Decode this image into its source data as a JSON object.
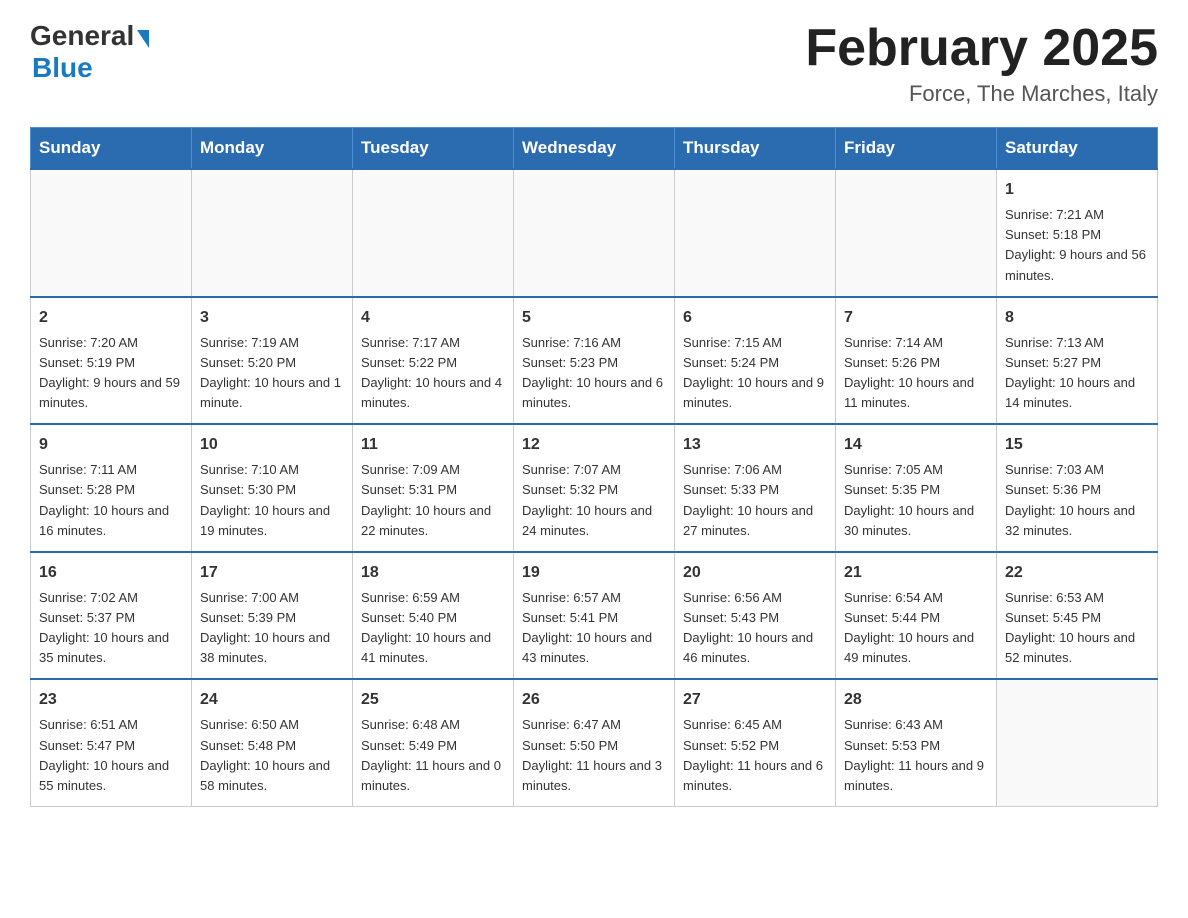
{
  "logo": {
    "general_text": "General",
    "blue_text": "Blue"
  },
  "header": {
    "month_year": "February 2025",
    "location": "Force, The Marches, Italy"
  },
  "days_of_week": [
    "Sunday",
    "Monday",
    "Tuesday",
    "Wednesday",
    "Thursday",
    "Friday",
    "Saturday"
  ],
  "weeks": [
    [
      {
        "day": "",
        "info": ""
      },
      {
        "day": "",
        "info": ""
      },
      {
        "day": "",
        "info": ""
      },
      {
        "day": "",
        "info": ""
      },
      {
        "day": "",
        "info": ""
      },
      {
        "day": "",
        "info": ""
      },
      {
        "day": "1",
        "info": "Sunrise: 7:21 AM\nSunset: 5:18 PM\nDaylight: 9 hours and 56 minutes."
      }
    ],
    [
      {
        "day": "2",
        "info": "Sunrise: 7:20 AM\nSunset: 5:19 PM\nDaylight: 9 hours and 59 minutes."
      },
      {
        "day": "3",
        "info": "Sunrise: 7:19 AM\nSunset: 5:20 PM\nDaylight: 10 hours and 1 minute."
      },
      {
        "day": "4",
        "info": "Sunrise: 7:17 AM\nSunset: 5:22 PM\nDaylight: 10 hours and 4 minutes."
      },
      {
        "day": "5",
        "info": "Sunrise: 7:16 AM\nSunset: 5:23 PM\nDaylight: 10 hours and 6 minutes."
      },
      {
        "day": "6",
        "info": "Sunrise: 7:15 AM\nSunset: 5:24 PM\nDaylight: 10 hours and 9 minutes."
      },
      {
        "day": "7",
        "info": "Sunrise: 7:14 AM\nSunset: 5:26 PM\nDaylight: 10 hours and 11 minutes."
      },
      {
        "day": "8",
        "info": "Sunrise: 7:13 AM\nSunset: 5:27 PM\nDaylight: 10 hours and 14 minutes."
      }
    ],
    [
      {
        "day": "9",
        "info": "Sunrise: 7:11 AM\nSunset: 5:28 PM\nDaylight: 10 hours and 16 minutes."
      },
      {
        "day": "10",
        "info": "Sunrise: 7:10 AM\nSunset: 5:30 PM\nDaylight: 10 hours and 19 minutes."
      },
      {
        "day": "11",
        "info": "Sunrise: 7:09 AM\nSunset: 5:31 PM\nDaylight: 10 hours and 22 minutes."
      },
      {
        "day": "12",
        "info": "Sunrise: 7:07 AM\nSunset: 5:32 PM\nDaylight: 10 hours and 24 minutes."
      },
      {
        "day": "13",
        "info": "Sunrise: 7:06 AM\nSunset: 5:33 PM\nDaylight: 10 hours and 27 minutes."
      },
      {
        "day": "14",
        "info": "Sunrise: 7:05 AM\nSunset: 5:35 PM\nDaylight: 10 hours and 30 minutes."
      },
      {
        "day": "15",
        "info": "Sunrise: 7:03 AM\nSunset: 5:36 PM\nDaylight: 10 hours and 32 minutes."
      }
    ],
    [
      {
        "day": "16",
        "info": "Sunrise: 7:02 AM\nSunset: 5:37 PM\nDaylight: 10 hours and 35 minutes."
      },
      {
        "day": "17",
        "info": "Sunrise: 7:00 AM\nSunset: 5:39 PM\nDaylight: 10 hours and 38 minutes."
      },
      {
        "day": "18",
        "info": "Sunrise: 6:59 AM\nSunset: 5:40 PM\nDaylight: 10 hours and 41 minutes."
      },
      {
        "day": "19",
        "info": "Sunrise: 6:57 AM\nSunset: 5:41 PM\nDaylight: 10 hours and 43 minutes."
      },
      {
        "day": "20",
        "info": "Sunrise: 6:56 AM\nSunset: 5:43 PM\nDaylight: 10 hours and 46 minutes."
      },
      {
        "day": "21",
        "info": "Sunrise: 6:54 AM\nSunset: 5:44 PM\nDaylight: 10 hours and 49 minutes."
      },
      {
        "day": "22",
        "info": "Sunrise: 6:53 AM\nSunset: 5:45 PM\nDaylight: 10 hours and 52 minutes."
      }
    ],
    [
      {
        "day": "23",
        "info": "Sunrise: 6:51 AM\nSunset: 5:47 PM\nDaylight: 10 hours and 55 minutes."
      },
      {
        "day": "24",
        "info": "Sunrise: 6:50 AM\nSunset: 5:48 PM\nDaylight: 10 hours and 58 minutes."
      },
      {
        "day": "25",
        "info": "Sunrise: 6:48 AM\nSunset: 5:49 PM\nDaylight: 11 hours and 0 minutes."
      },
      {
        "day": "26",
        "info": "Sunrise: 6:47 AM\nSunset: 5:50 PM\nDaylight: 11 hours and 3 minutes."
      },
      {
        "day": "27",
        "info": "Sunrise: 6:45 AM\nSunset: 5:52 PM\nDaylight: 11 hours and 6 minutes."
      },
      {
        "day": "28",
        "info": "Sunrise: 6:43 AM\nSunset: 5:53 PM\nDaylight: 11 hours and 9 minutes."
      },
      {
        "day": "",
        "info": ""
      }
    ]
  ]
}
